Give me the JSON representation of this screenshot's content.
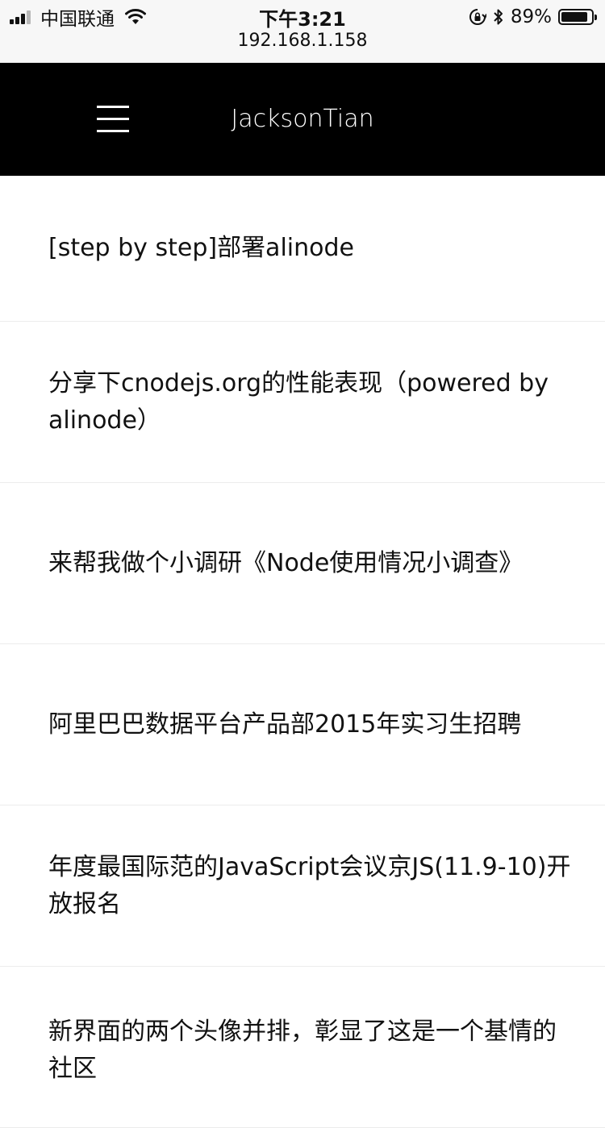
{
  "status_bar": {
    "carrier": "中国联通",
    "time": "下午3:21",
    "url": "192.168.1.158",
    "battery_percent_label": "89%",
    "battery_level": 0.89,
    "signal_bars_active": 3,
    "signal_bars_total": 4,
    "icons": [
      "signal-icon",
      "wifi-icon",
      "rotation-lock-icon",
      "bluetooth-icon",
      "battery-icon"
    ]
  },
  "header": {
    "title": "JacksonTian",
    "menu_icon": "hamburger-menu-icon"
  },
  "topics": [
    {
      "title": "[step by step]部署alinode"
    },
    {
      "title": "分享下cnodejs.org的性能表现（powered by alinode）"
    },
    {
      "title": "来帮我做个小调研《Node使用情况小调查》"
    },
    {
      "title": "阿里巴巴数据平台产品部2015年实习生招聘"
    },
    {
      "title": "年度最国际范的JavaScript会议京JS(11.9-10)开放报名"
    },
    {
      "title": "新界面的两个头像并排，彰显了这是一个基情的社区"
    }
  ],
  "colors": {
    "header_background": "#000000",
    "header_text": "#ffffff",
    "status_bar_background": "#f7f7f7",
    "list_background": "#ffffff",
    "divider": "#ececec",
    "text": "#111111"
  }
}
